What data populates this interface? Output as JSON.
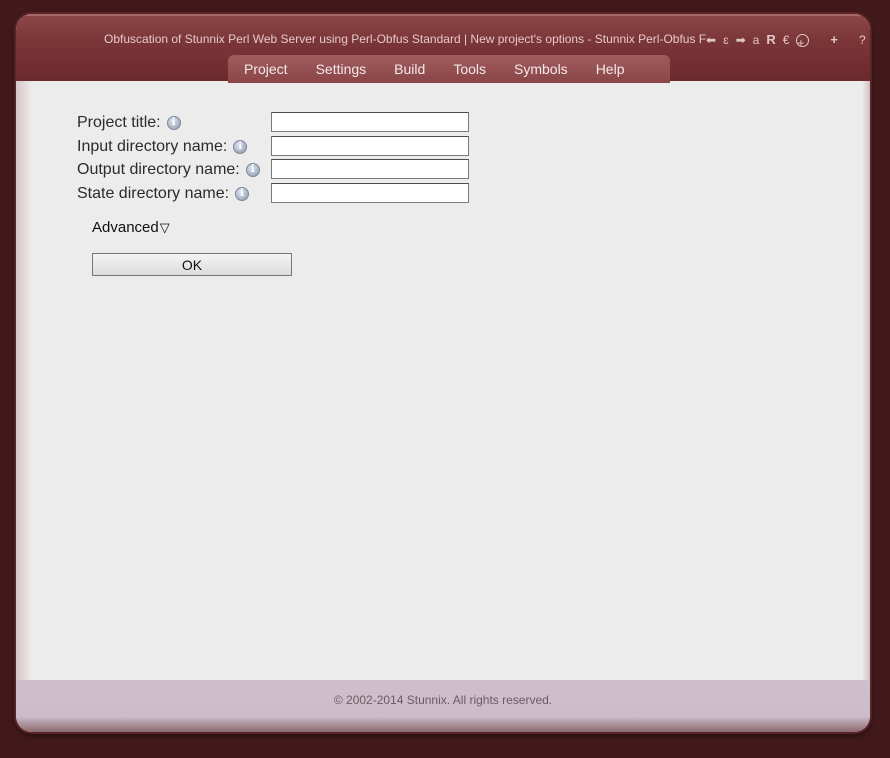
{
  "window": {
    "title": "Obfuscation of Stunnix Perl Web Server using Perl-Obfus Standard | New project's options - Stunnix Perl-Obfus F",
    "controls": [
      {
        "name": "back-arrow-icon",
        "glyph": "⬅"
      },
      {
        "name": "ellipsis-icon",
        "glyph": "ɛ"
      },
      {
        "name": "forward-arrow-icon",
        "glyph": "➡"
      },
      {
        "name": "a-icon",
        "glyph": "a"
      },
      {
        "name": "r-icon",
        "glyph": "R"
      },
      {
        "name": "e-icon",
        "glyph": "€"
      },
      {
        "name": "zoom-in-icon",
        "glyph": "+"
      },
      {
        "name": "add-icon",
        "glyph": "+"
      },
      {
        "name": "help-icon",
        "glyph": "?"
      }
    ]
  },
  "menu": {
    "items": [
      "Project",
      "Settings",
      "Build",
      "Tools",
      "Symbols",
      "Help"
    ]
  },
  "form": {
    "project_title_label": "Project title:",
    "input_dir_label": "Input directory name:",
    "output_dir_label": "Output directory name:",
    "state_dir_label": "State directory name:",
    "project_title_value": "",
    "input_dir_value": "",
    "output_dir_value": "",
    "state_dir_value": "",
    "info_glyph": "i",
    "advanced_label": "Advanced",
    "advanced_arrow": "▽",
    "ok_label": "OK"
  },
  "footer": {
    "text": "© 2002-2014 Stunnix. All rights reserved."
  },
  "colors": {
    "background": "#431a1c",
    "titlebar": "#7a3537",
    "menubar": "#97525a",
    "footer": "#cfbfcc"
  }
}
